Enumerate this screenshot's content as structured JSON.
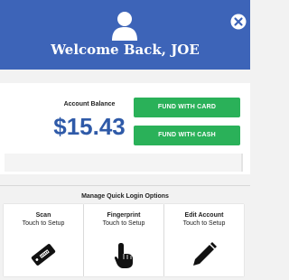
{
  "header": {
    "welcome_text": "Welcome Back, JOE",
    "user_icon": "user-icon",
    "close_icon": "close-icon",
    "background_color": "#3d64b8"
  },
  "balance": {
    "label": "Account Balance",
    "value": "$15.43",
    "value_color": "#2f5aa8"
  },
  "actions": {
    "fund_with_card": "FUND WITH CARD",
    "fund_with_cash": "FUND WITH CASH",
    "button_color": "#2ab159"
  },
  "quick_login": {
    "title": "Manage Quick Login Options",
    "tiles": [
      {
        "title": "Scan",
        "subtitle": "Touch to Setup",
        "icon": "card-scan-icon"
      },
      {
        "title": "Fingerprint",
        "subtitle": "Touch to Setup",
        "icon": "fingerprint-touch-icon"
      },
      {
        "title": "Edit Account",
        "subtitle": "Touch to Setup",
        "icon": "pencil-icon"
      }
    ]
  }
}
